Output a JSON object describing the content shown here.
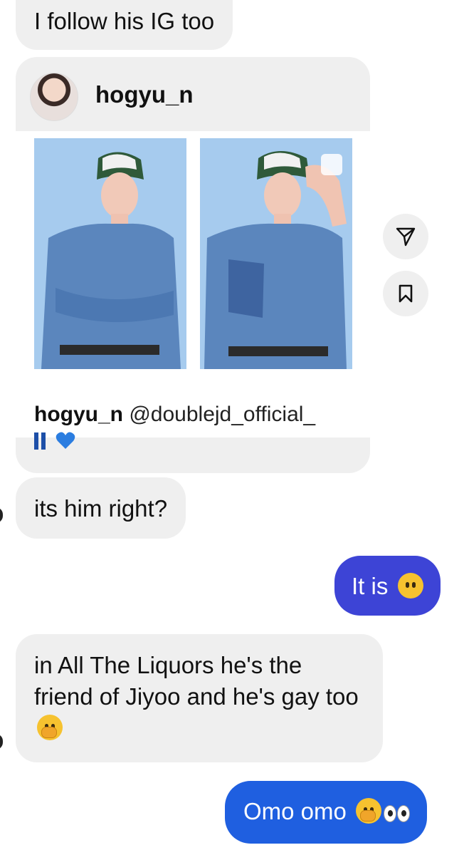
{
  "messages": {
    "m1": "I follow his IG too",
    "m2": "its him right?",
    "m3": "It is",
    "m4": "in All The Liquors he's the friend of Jiyoo and he's gay too",
    "m5": "Omo omo"
  },
  "shared_post": {
    "username": "hogyu_n",
    "caption_user": "hogyu_n",
    "caption_mention": "@doublejd_official_",
    "caption_emojis": [
      "jeans-icon",
      "blue-heart-icon"
    ]
  },
  "colors": {
    "incoming_bubble": "#efefef",
    "outgoing_bubble_1": "#3d44d6",
    "outgoing_bubble_2": "#1f5fe0"
  },
  "icons": [
    "send-icon",
    "bookmark-icon",
    "multi-photo-icon"
  ]
}
